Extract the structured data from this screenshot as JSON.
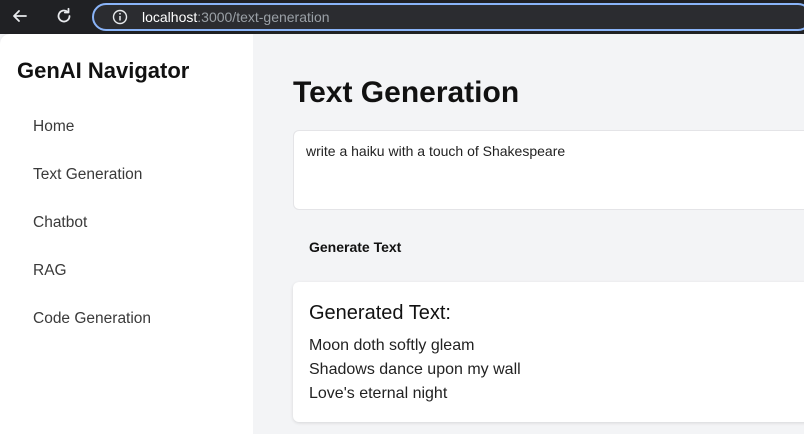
{
  "browser": {
    "url_host": "localhost",
    "url_rest": ":3000/text-generation"
  },
  "sidebar": {
    "brand": "GenAI Navigator",
    "items": [
      {
        "label": "Home"
      },
      {
        "label": "Text Generation"
      },
      {
        "label": "Chatbot"
      },
      {
        "label": "RAG"
      },
      {
        "label": "Code Generation"
      }
    ]
  },
  "main": {
    "title": "Text Generation",
    "prompt_value": "write a haiku with a touch of Shakespeare",
    "generate_label": "Generate Text",
    "result_heading": "Generated Text:",
    "result_lines": [
      "Moon doth softly gleam",
      "Shadows dance upon my wall",
      "Love's eternal night"
    ]
  },
  "colors": {
    "browser_bar": "#202124",
    "address_focus": "#8ab4f8",
    "sidebar_bg": "#ffffff",
    "main_bg": "#f3f4f6"
  }
}
